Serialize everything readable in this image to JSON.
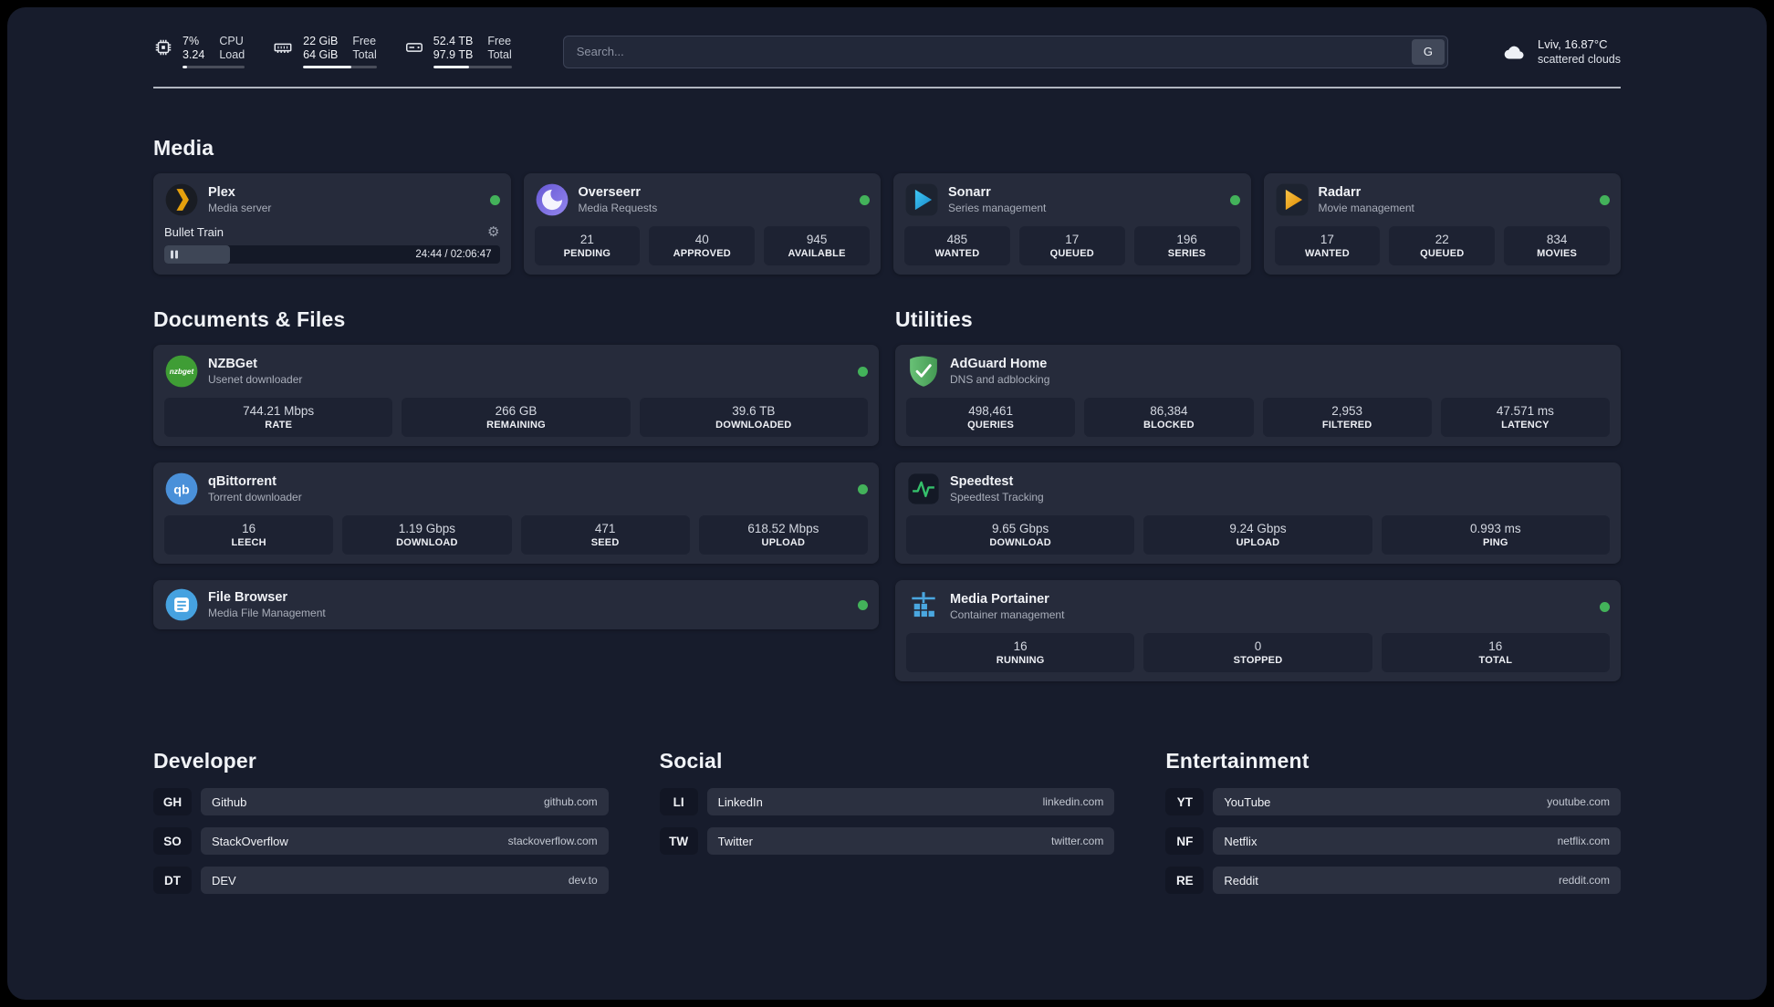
{
  "topbar": {
    "cpu": {
      "line1": "7%",
      "line2": "3.24",
      "label1": "CPU",
      "label2": "Load",
      "bar_pct": 7
    },
    "ram": {
      "line1": "22 GiB",
      "line2": "64 GiB",
      "label1": "Free",
      "label2": "Total",
      "bar_pct": 66
    },
    "disk": {
      "line1": "52.4 TB",
      "line2": "97.9 TB",
      "label1": "Free",
      "label2": "Total",
      "bar_pct": 46
    },
    "search": {
      "placeholder": "Search...",
      "button": "G"
    },
    "weather": {
      "line1": "Lviv, 16.87°C",
      "line2": "scattered clouds"
    }
  },
  "media": {
    "title": "Media",
    "plex": {
      "name": "Plex",
      "subtitle": "Media server",
      "now_playing": "Bullet Train",
      "time": "24:44 / 02:06:47",
      "progress_pct": 19.5
    },
    "overseerr": {
      "name": "Overseerr",
      "subtitle": "Media Requests",
      "stats": [
        {
          "value": "21",
          "label": "PENDING"
        },
        {
          "value": "40",
          "label": "APPROVED"
        },
        {
          "value": "945",
          "label": "AVAILABLE"
        }
      ]
    },
    "sonarr": {
      "name": "Sonarr",
      "subtitle": "Series management",
      "stats": [
        {
          "value": "485",
          "label": "WANTED"
        },
        {
          "value": "17",
          "label": "QUEUED"
        },
        {
          "value": "196",
          "label": "SERIES"
        }
      ]
    },
    "radarr": {
      "name": "Radarr",
      "subtitle": "Movie management",
      "stats": [
        {
          "value": "17",
          "label": "WANTED"
        },
        {
          "value": "22",
          "label": "QUEUED"
        },
        {
          "value": "834",
          "label": "MOVIES"
        }
      ]
    }
  },
  "documents": {
    "title": "Documents & Files",
    "nzbget": {
      "name": "NZBGet",
      "subtitle": "Usenet downloader",
      "stats": [
        {
          "value": "744.21 Mbps",
          "label": "RATE"
        },
        {
          "value": "266 GB",
          "label": "REMAINING"
        },
        {
          "value": "39.6 TB",
          "label": "DOWNLOADED"
        }
      ]
    },
    "qbittorrent": {
      "name": "qBittorrent",
      "subtitle": "Torrent downloader",
      "stats": [
        {
          "value": "16",
          "label": "LEECH"
        },
        {
          "value": "1.19 Gbps",
          "label": "DOWNLOAD"
        },
        {
          "value": "471",
          "label": "SEED"
        },
        {
          "value": "618.52 Mbps",
          "label": "UPLOAD"
        }
      ]
    },
    "filebrowser": {
      "name": "File Browser",
      "subtitle": "Media File Management"
    }
  },
  "utilities": {
    "title": "Utilities",
    "adguard": {
      "name": "AdGuard Home",
      "subtitle": "DNS and adblocking",
      "stats": [
        {
          "value": "498,461",
          "label": "QUERIES"
        },
        {
          "value": "86,384",
          "label": "BLOCKED"
        },
        {
          "value": "2,953",
          "label": "FILTERED"
        },
        {
          "value": "47.571 ms",
          "label": "LATENCY"
        }
      ]
    },
    "speedtest": {
      "name": "Speedtest",
      "subtitle": "Speedtest Tracking",
      "stats": [
        {
          "value": "9.65 Gbps",
          "label": "DOWNLOAD"
        },
        {
          "value": "9.24 Gbps",
          "label": "UPLOAD"
        },
        {
          "value": "0.993 ms",
          "label": "PING"
        }
      ]
    },
    "portainer": {
      "name": "Media Portainer",
      "subtitle": "Container management",
      "stats": [
        {
          "value": "16",
          "label": "RUNNING"
        },
        {
          "value": "0",
          "label": "STOPPED"
        },
        {
          "value": "16",
          "label": "TOTAL"
        }
      ]
    }
  },
  "bookmarks": {
    "developer": {
      "title": "Developer",
      "items": [
        {
          "abbr": "GH",
          "name": "Github",
          "url": "github.com"
        },
        {
          "abbr": "SO",
          "name": "StackOverflow",
          "url": "stackoverflow.com"
        },
        {
          "abbr": "DT",
          "name": "DEV",
          "url": "dev.to"
        }
      ]
    },
    "social": {
      "title": "Social",
      "items": [
        {
          "abbr": "LI",
          "name": "LinkedIn",
          "url": "linkedin.com"
        },
        {
          "abbr": "TW",
          "name": "Twitter",
          "url": "twitter.com"
        }
      ]
    },
    "entertainment": {
      "title": "Entertainment",
      "items": [
        {
          "abbr": "YT",
          "name": "YouTube",
          "url": "youtube.com"
        },
        {
          "abbr": "NF",
          "name": "Netflix",
          "url": "netflix.com"
        },
        {
          "abbr": "RE",
          "name": "Reddit",
          "url": "reddit.com"
        }
      ]
    }
  },
  "colors": {
    "status_online": "#43b25a",
    "accent_amber": "#e5a00d"
  }
}
